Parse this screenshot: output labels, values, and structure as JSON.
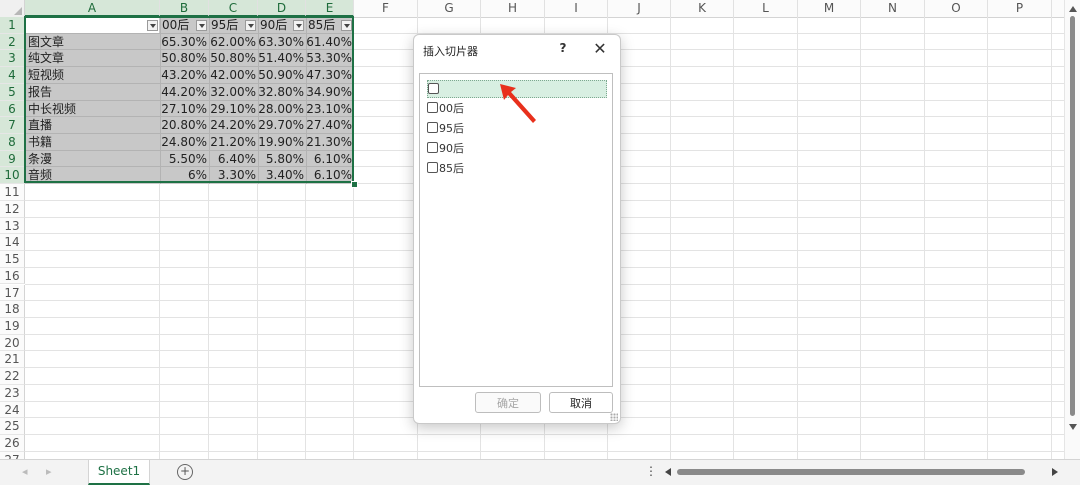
{
  "columns": [
    "A",
    "B",
    "C",
    "D",
    "E",
    "F",
    "G",
    "H",
    "I",
    "J",
    "K",
    "L",
    "M",
    "N",
    "O",
    "P"
  ],
  "rows": [
    "1",
    "2",
    "3",
    "4",
    "5",
    "6",
    "7",
    "8",
    "9",
    "10",
    "11",
    "12",
    "13",
    "14",
    "15",
    "16",
    "17",
    "18",
    "19",
    "20",
    "21",
    "22",
    "23",
    "24",
    "25",
    "26",
    "27"
  ],
  "table": {
    "headers": [
      "00后",
      "95后",
      "90后",
      "85后"
    ],
    "data": [
      {
        "label": "图文章",
        "values": [
          "65.30%",
          "62.00%",
          "63.30%",
          "61.40%"
        ]
      },
      {
        "label": "纯文章",
        "values": [
          "50.80%",
          "50.80%",
          "51.40%",
          "53.30%"
        ]
      },
      {
        "label": "短视频",
        "values": [
          "43.20%",
          "42.00%",
          "50.90%",
          "47.30%"
        ]
      },
      {
        "label": "报告",
        "values": [
          "44.20%",
          "32.00%",
          "32.80%",
          "34.90%"
        ]
      },
      {
        "label": "中长视频",
        "values": [
          "27.10%",
          "29.10%",
          "28.00%",
          "23.10%"
        ]
      },
      {
        "label": "直播",
        "values": [
          "20.80%",
          "24.20%",
          "29.70%",
          "27.40%"
        ]
      },
      {
        "label": "书籍",
        "values": [
          "24.80%",
          "21.20%",
          "19.90%",
          "21.30%"
        ]
      },
      {
        "label": "条漫",
        "values": [
          "5.50%",
          "6.40%",
          "5.80%",
          "6.10%"
        ]
      },
      {
        "label": "音频",
        "values": [
          "6%",
          "3.30%",
          "3.40%",
          "6.10%"
        ]
      }
    ]
  },
  "dialog": {
    "title": "插入切片器",
    "help": "?",
    "close": "✕",
    "items": [
      "",
      "00后",
      "95后",
      "90后",
      "85后"
    ],
    "ok_label": "确定",
    "cancel_label": "取消"
  },
  "tabs": {
    "sheet_name": "Sheet1",
    "add": "+",
    "menu": "⋮"
  },
  "colors": {
    "accent": "#1e7145",
    "selection_fill": "#c8c8c8",
    "annotation_arrow": "#e8301c"
  }
}
